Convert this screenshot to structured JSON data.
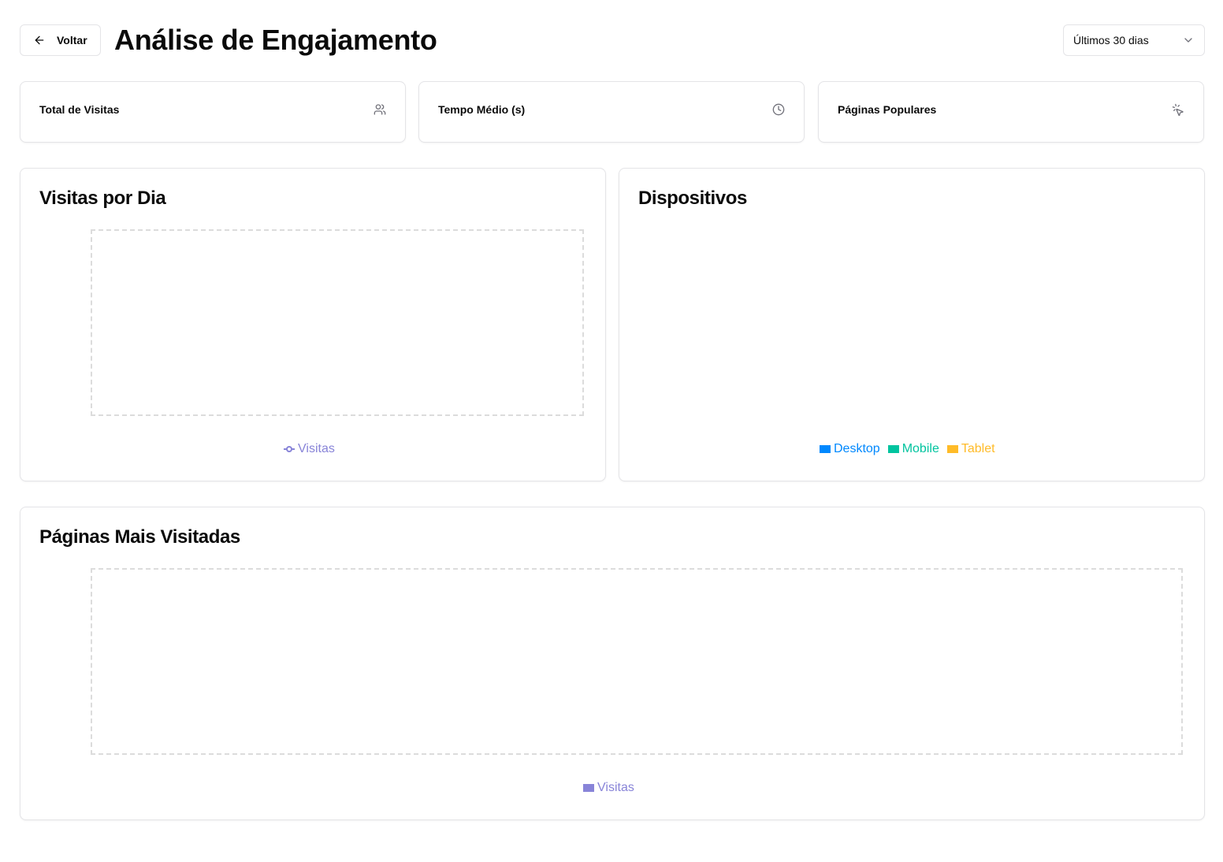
{
  "header": {
    "back_label": "Voltar",
    "title": "Análise de Engajamento",
    "range_selected": "Últimos 30 dias"
  },
  "stats": [
    {
      "label": "Total de Visitas",
      "icon": "users-icon"
    },
    {
      "label": "Tempo Médio (s)",
      "icon": "clock-icon"
    },
    {
      "label": "Páginas Populares",
      "icon": "pointer-click-icon"
    }
  ],
  "colors": {
    "visits": "#8884d8",
    "desktop": "#0088fe",
    "mobile": "#00c49f",
    "tablet": "#ffbb28"
  },
  "visits_by_day": {
    "title": "Visitas por Dia",
    "legend": "Visitas"
  },
  "devices": {
    "title": "Dispositivos",
    "legend": {
      "desktop": "Desktop",
      "mobile": "Mobile",
      "tablet": "Tablet"
    }
  },
  "top_pages": {
    "title": "Páginas Mais Visitadas",
    "legend": "Visitas"
  },
  "chart_data": [
    {
      "type": "line",
      "series": [
        {
          "name": "Visitas",
          "values": []
        }
      ],
      "x": []
    },
    {
      "type": "pie",
      "categories": [
        "Desktop",
        "Mobile",
        "Tablet"
      ],
      "values": []
    },
    {
      "type": "bar",
      "series": [
        {
          "name": "Visitas",
          "values": []
        }
      ],
      "categories": []
    }
  ]
}
